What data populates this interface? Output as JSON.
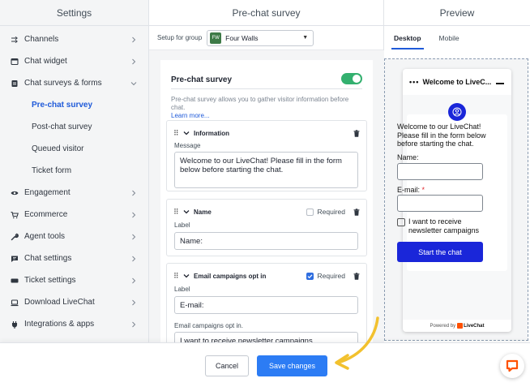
{
  "sidebar": {
    "title": "Settings",
    "items": [
      {
        "label": "Channels",
        "icon": "channels-icon"
      },
      {
        "label": "Chat widget",
        "icon": "widget-icon"
      },
      {
        "label": "Chat surveys & forms",
        "icon": "forms-icon",
        "expanded": true
      },
      {
        "label": "Engagement",
        "icon": "eye-icon"
      },
      {
        "label": "Ecommerce",
        "icon": "cart-icon"
      },
      {
        "label": "Agent tools",
        "icon": "wrench-icon"
      },
      {
        "label": "Chat settings",
        "icon": "chat-icon"
      },
      {
        "label": "Ticket settings",
        "icon": "ticket-icon"
      },
      {
        "label": "Download LiveChat",
        "icon": "download-icon"
      },
      {
        "label": "Integrations & apps",
        "icon": "plug-icon"
      }
    ],
    "subitems": [
      {
        "label": "Pre-chat survey",
        "active": true
      },
      {
        "label": "Post-chat survey"
      },
      {
        "label": "Queued visitor"
      },
      {
        "label": "Ticket form"
      }
    ]
  },
  "main": {
    "title": "Pre-chat survey",
    "group_label": "Setup for group",
    "group_badge": "FW",
    "group_name": "Four Walls",
    "section_title": "Pre-chat survey",
    "enabled": true,
    "description": "Pre-chat survey allows you to gather visitor information before chat.",
    "learn_more": "Learn more...",
    "cards": {
      "information": {
        "title": "Information",
        "field_label": "Message",
        "value": "Welcome to our LiveChat! Please fill in the form below before starting the chat."
      },
      "name": {
        "title": "Name",
        "required_label": "Required",
        "required": false,
        "field_label": "Label",
        "value": "Name:"
      },
      "email": {
        "title": "Email campaigns opt in",
        "required_label": "Required",
        "required": true,
        "field_label": "Label",
        "value": "E-mail:",
        "optin_label": "Email campaigns opt in.",
        "optin_value": "I want to receive newsletter campaigns"
      }
    }
  },
  "preview": {
    "title": "Preview",
    "tabs": [
      {
        "label": "Desktop",
        "active": true
      },
      {
        "label": "Mobile"
      }
    ],
    "widget": {
      "dots": "•••",
      "title": "Welcome to LiveC...",
      "message": "Welcome to our LiveChat! Please fill in the form below before starting the chat.",
      "name_label": "Name:",
      "email_label": "E-mail:",
      "required_mark": "*",
      "checkbox_label": "I want to receive newsletter campaigns",
      "start_button": "Start the chat",
      "powered_by": "Powered by",
      "brand": "LiveChat"
    }
  },
  "footer": {
    "cancel_label": "Cancel",
    "save_label": "Save changes"
  },
  "colors": {
    "accent": "#2c7cf4",
    "active_link": "#1f5ad9",
    "toggle_on": "#33b06f",
    "widget_primary": "#1a26d9",
    "brand_orange": "#ff5100",
    "arrow": "#f2c12e"
  }
}
